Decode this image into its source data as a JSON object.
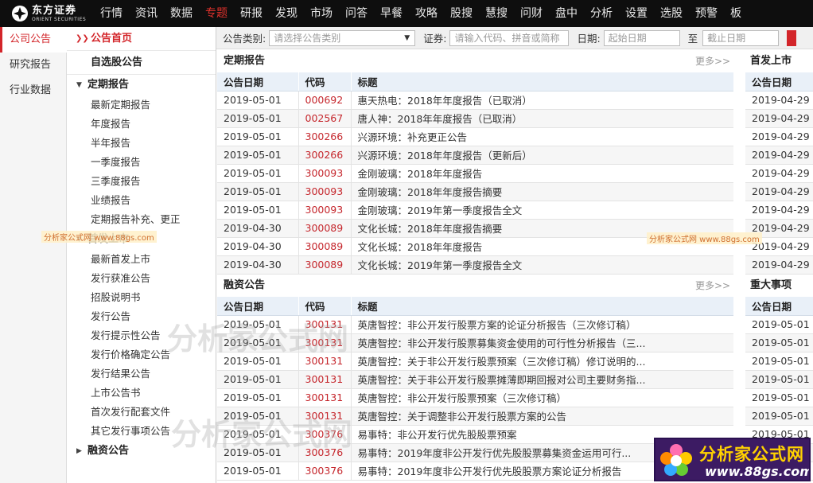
{
  "brand": {
    "name_cn": "东方证券",
    "name_en": "ORIENT SECURITIES"
  },
  "topnav": [
    "行情",
    "资讯",
    "数据",
    "专题",
    "研报",
    "发现",
    "市场",
    "问答",
    "早餐",
    "攻略",
    "股搜",
    "慧搜",
    "问财",
    "盘中",
    "分析",
    "设置",
    "选股",
    "预警",
    "板"
  ],
  "topnav_active": "专题",
  "left_menu": [
    "公司公告",
    "研究报告",
    "行业数据"
  ],
  "tree": {
    "home": "公告首页",
    "watchlist": "自选股公告",
    "groups": [
      {
        "label": "定期报告",
        "children": [
          "最新定期报告",
          "年度报告",
          "半年报告",
          "一季度报告",
          "三季度报告",
          "业绩报告",
          "定期报告补充、更正"
        ]
      },
      {
        "label": "首发上市",
        "children": [
          "最新首发上市",
          "发行获准公告",
          "招股说明书",
          "发行公告",
          "发行提示性公告",
          "发行价格确定公告",
          "发行结果公告",
          "上市公告书",
          "首次发行配套文件",
          "其它发行事项公告"
        ]
      },
      {
        "label": "融资公告",
        "children": []
      }
    ]
  },
  "filter": {
    "type_label": "公告类别:",
    "type_placeholder": "请选择公告类别",
    "stock_label": "证券:",
    "stock_placeholder": "请输入代码、拼音或简称",
    "date_label": "日期:",
    "start_placeholder": "起始日期",
    "to_label": "至",
    "end_placeholder": "截止日期"
  },
  "sections": {
    "periodic": {
      "title": "定期报告",
      "more": "更多>>",
      "columns": [
        "公告日期",
        "代码",
        "标题"
      ],
      "rows": [
        [
          "2019-05-01",
          "000692",
          "惠天热电：2018年年度报告（已取消）"
        ],
        [
          "2019-05-01",
          "002567",
          "唐人神：2018年年度报告（已取消）"
        ],
        [
          "2019-05-01",
          "300266",
          "兴源环境：补充更正公告"
        ],
        [
          "2019-05-01",
          "300266",
          "兴源环境：2018年年度报告（更新后）"
        ],
        [
          "2019-05-01",
          "300093",
          "金刚玻璃：2018年年度报告"
        ],
        [
          "2019-05-01",
          "300093",
          "金刚玻璃：2018年年度报告摘要"
        ],
        [
          "2019-05-01",
          "300093",
          "金刚玻璃：2019年第一季度报告全文"
        ],
        [
          "2019-04-30",
          "300089",
          "文化长城：2018年年度报告摘要"
        ],
        [
          "2019-04-30",
          "300089",
          "文化长城：2018年年度报告"
        ],
        [
          "2019-04-30",
          "300089",
          "文化长城：2019年第一季度报告全文"
        ]
      ]
    },
    "financing": {
      "title": "融资公告",
      "more": "更多>>",
      "columns": [
        "公告日期",
        "代码",
        "标题"
      ],
      "rows": [
        [
          "2019-05-01",
          "300131",
          "英唐智控：非公开发行股票方案的论证分析报告（三次修订稿）"
        ],
        [
          "2019-05-01",
          "300131",
          "英唐智控：非公开发行股票募集资金使用的可行性分析报告（三..."
        ],
        [
          "2019-05-01",
          "300131",
          "英唐智控：关于非公开发行股票预案（三次修订稿）修订说明的..."
        ],
        [
          "2019-05-01",
          "300131",
          "英唐智控：关于非公开发行股票摊薄即期回报对公司主要财务指..."
        ],
        [
          "2019-05-01",
          "300131",
          "英唐智控：非公开发行股票预案（三次修订稿）"
        ],
        [
          "2019-05-01",
          "300131",
          "英唐智控：关于调整非公开发行股票方案的公告"
        ],
        [
          "2019-05-01",
          "300376",
          "易事特：非公开发行优先股股票预案"
        ],
        [
          "2019-05-01",
          "300376",
          "易事特：2019年度非公开发行优先股股票募集资金运用可行..."
        ],
        [
          "2019-05-01",
          "300376",
          "易事特：2019年度非公开发行优先股股票方案论证分析报告"
        ]
      ]
    },
    "ipo": {
      "title": "首发上市",
      "column": "公告日期",
      "dates": [
        "2019-04-29",
        "2019-04-29",
        "2019-04-29",
        "2019-04-29",
        "2019-04-29",
        "2019-04-29",
        "2019-04-29",
        "2019-04-29",
        "2019-04-29",
        "2019-04-29"
      ]
    },
    "major": {
      "title": "重大事项",
      "column": "公告日期",
      "dates": [
        "2019-05-01",
        "2019-05-01",
        "2019-05-01",
        "2019-05-01",
        "2019-05-01",
        "2019-05-01",
        "2019-05-01",
        "2019-05-01",
        "2019-05-01"
      ]
    }
  },
  "watermark": {
    "text": "分析家公式网",
    "url": "www.88gs.com",
    "small": "分析家公式网 www.88gs.com"
  },
  "colors": {
    "accent": "#d3252a",
    "topbar": "#0e0e0e",
    "header_row": "#e9f0f8"
  }
}
